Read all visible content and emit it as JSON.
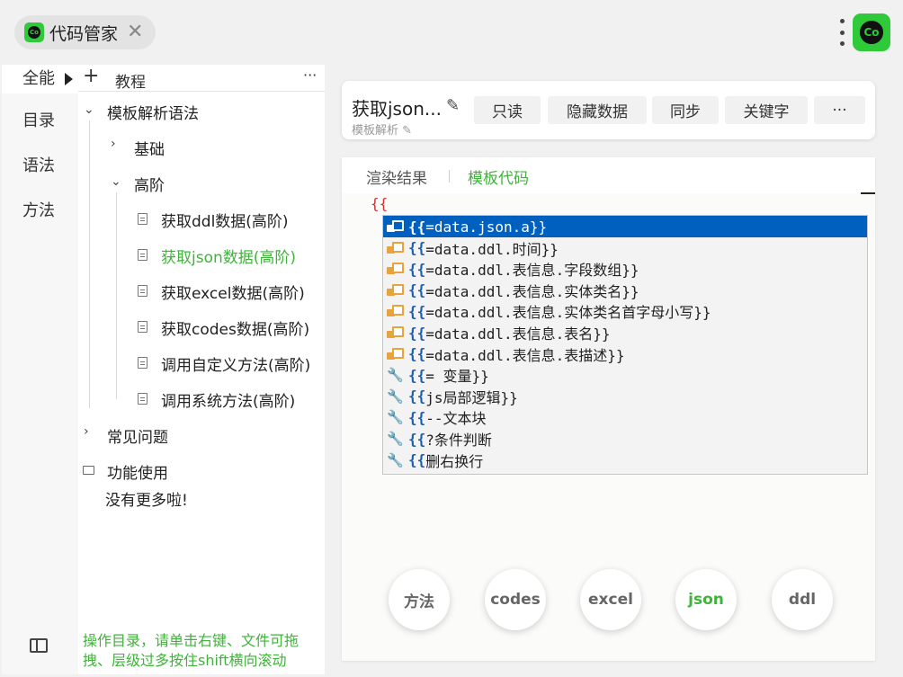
{
  "app": {
    "tab_title": "代码管家",
    "tab_close": "✕",
    "logo_text": "Co"
  },
  "rail": {
    "items": [
      "全能",
      "目录",
      "语法",
      "方法"
    ]
  },
  "tree": {
    "header_label": "教程",
    "add": "+",
    "more": "···",
    "nodes": {
      "root": "模板解析语法",
      "basics": "基础",
      "advanced": "高阶",
      "ddl": "获取ddl数据(高阶)",
      "json": "获取json数据(高阶)",
      "excel": "获取excel数据(高阶)",
      "codes": "获取codes数据(高阶)",
      "custom_method": "调用自定义方法(高阶)",
      "system_method": "调用系统方法(高阶)",
      "faq": "常见问题",
      "usage": "功能使用"
    },
    "no_more": "没有更多啦!",
    "hint": "操作目录，请单击右键、文件可拖拽、层级过多按住shift横向滚动"
  },
  "card": {
    "title": "获取json...",
    "subtitle": "模板解析",
    "buttons": [
      "只读",
      "隐藏数据",
      "同步",
      "关键字",
      "···"
    ]
  },
  "editor": {
    "tabs": [
      "渲染结果",
      "模板代码"
    ],
    "code_line": "{{"
  },
  "suggestions": [
    {
      "icon": "struct",
      "brace": "{{",
      "text": "=data.json.a}}"
    },
    {
      "icon": "struct",
      "brace": "{{",
      "text": "=data.ddl.时间}}"
    },
    {
      "icon": "struct",
      "brace": "{{",
      "text": "=data.ddl.表信息.字段数组}}"
    },
    {
      "icon": "struct",
      "brace": "{{",
      "text": "=data.ddl.表信息.实体类名}}"
    },
    {
      "icon": "struct",
      "brace": "{{",
      "text": "=data.ddl.表信息.实体类名首字母小写}}"
    },
    {
      "icon": "struct",
      "brace": "{{",
      "text": "=data.ddl.表信息.表名}}"
    },
    {
      "icon": "struct",
      "brace": "{{",
      "text": "=data.ddl.表信息.表描述}}"
    },
    {
      "icon": "wrench",
      "brace": "{{",
      "text": "= 变量}}"
    },
    {
      "icon": "wrench",
      "brace": "{{",
      "text": "js局部逻辑}}"
    },
    {
      "icon": "wrench",
      "brace": "{{",
      "text": "--文本块"
    },
    {
      "icon": "wrench",
      "brace": "{{",
      "text": "?条件判断"
    },
    {
      "icon": "wrench",
      "brace": "{{",
      "text": "删右换行"
    }
  ],
  "circle_buttons": [
    "方法",
    "codes",
    "excel",
    "json",
    "ddl"
  ],
  "colors": {
    "accent": "#3fb33a",
    "selection": "#0060c0"
  }
}
